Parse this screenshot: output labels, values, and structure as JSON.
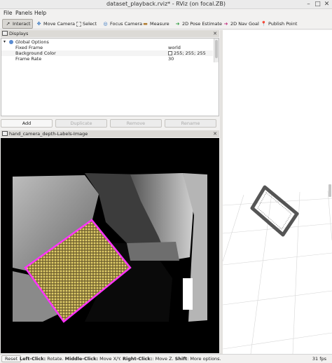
{
  "window": {
    "title": "dataset_playback.rviz* - RViz (on focal.ZB)"
  },
  "menu": [
    "File",
    "Panels",
    "Help"
  ],
  "toolbar": {
    "tools": [
      {
        "label": "Interact",
        "icon": "cursor-icon",
        "active": true
      },
      {
        "label": "Move Camera",
        "icon": "move-camera-icon"
      },
      {
        "label": "Select",
        "icon": "select-icon"
      },
      {
        "label": "Focus Camera",
        "icon": "focus-camera-icon"
      },
      {
        "label": "Measure",
        "icon": "measure-icon"
      },
      {
        "label": "2D Pose Estimate",
        "icon": "pose-estimate-icon"
      },
      {
        "label": "2D Nav Goal",
        "icon": "nav-goal-icon"
      },
      {
        "label": "Publish Point",
        "icon": "publish-point-icon"
      }
    ]
  },
  "displays": {
    "title": "Displays",
    "group": "Global Options",
    "properties": [
      {
        "name": "Fixed Frame",
        "value": "world"
      },
      {
        "name": "Background Color",
        "value": "255; 255; 255"
      },
      {
        "name": "Frame Rate",
        "value": "30"
      }
    ],
    "buttons": {
      "add": "Add",
      "duplicate": "Duplicate",
      "remove": "Remove",
      "rename": "Rename"
    }
  },
  "image_panel": {
    "title": "hand_camera_depth-Labels-Image"
  },
  "status": {
    "reset": "Reset",
    "hints": [
      {
        "key": "Left-Click:",
        "text": " Rotate. "
      },
      {
        "key": "Middle-Click:",
        "text": " Move X/Y. "
      },
      {
        "key": "Right-Click:",
        "text": ": Move Z. "
      },
      {
        "key": "Shift",
        "text": ": More options."
      }
    ],
    "fps": "31 fps"
  },
  "colors": {
    "label_outline": "#ff33ff",
    "label_fill": "#c8b45a",
    "background": "#ffffff"
  }
}
